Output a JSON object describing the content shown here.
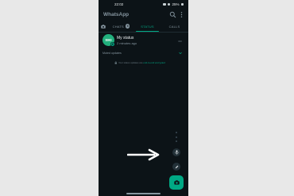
{
  "status_bar": {
    "time": "22:02",
    "battery": "25%",
    "icons": [
      "signal-icon",
      "wifi-icon",
      "battery-icon"
    ]
  },
  "header": {
    "title": "WhatsApp",
    "actions": [
      "search-icon",
      "overflow-menu-icon"
    ]
  },
  "tabs": [
    {
      "label": "",
      "icon": "camera-icon"
    },
    {
      "label": "CHATS",
      "badge": "5"
    },
    {
      "label": "STATUS",
      "selected": true
    },
    {
      "label": "CALLS"
    }
  ],
  "my_status": {
    "avatar_text": "SIKI",
    "name": "My status",
    "subtitle": "2 minutes ago",
    "menu": "•••"
  },
  "muted": {
    "label": "Muted updates"
  },
  "updates_note": {
    "text": "Your status updates are ",
    "link": "end-to-end encrypted"
  },
  "fabs": [
    "mic-icon",
    "pencil-icon",
    "camera-icon"
  ],
  "colors": {
    "accent": "#00a884",
    "background": "#0c1317",
    "overlay_arrow": "#ffffff"
  }
}
